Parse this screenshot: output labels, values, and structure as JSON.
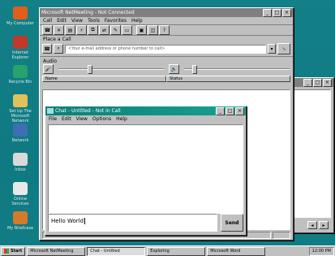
{
  "desktop": {
    "icons": [
      {
        "label": "My Computer",
        "color": "#e35d1c",
        "icon": "my-computer-icon"
      },
      {
        "label": "Internet Explorer",
        "color": "#c0392b",
        "icon": "internet-icon"
      },
      {
        "label": "Recycle Bin",
        "color": "#27a36b",
        "icon": "recycle-bin-icon"
      },
      {
        "label": "Set Up The Microsoft Network",
        "color": "#e2c15a",
        "icon": "msn-icon"
      },
      {
        "label": "Network",
        "color": "#3e6fb5",
        "icon": "network-icon"
      },
      {
        "label": "Inbox",
        "color": "#d9d9d9",
        "icon": "inbox-icon"
      },
      {
        "label": "Online Services",
        "color": "#e8e8e8",
        "icon": "online-services-icon"
      },
      {
        "label": "My Briefcase",
        "color": "#d47a2a",
        "icon": "briefcase-icon"
      }
    ]
  },
  "netmeeting": {
    "title": "Microsoft NetMeeting - Not Connected",
    "menu": [
      "Call",
      "Edit",
      "View",
      "Tools",
      "Favorites",
      "Help"
    ],
    "place_call_label": "Place a Call",
    "address_placeholder": "<Your e-mail address or phone number to call>",
    "audio_label": "Audio",
    "columns": [
      "Name",
      "Status"
    ],
    "status_text": "Not Connected"
  },
  "chat": {
    "title": "Chat - Untitled - Not in Call",
    "menu": [
      "File",
      "Edit",
      "View",
      "Options",
      "Help"
    ],
    "message_value": "Hello World",
    "send_label": "Send"
  },
  "background_window": {
    "title": ""
  },
  "taskbar": {
    "start_label": "Start",
    "tasks": [
      "Microsoft NetMeeting",
      "Chat - Untitled",
      "Exploring",
      "Microsoft Word"
    ],
    "clock": "12:00 PM"
  },
  "colors": {
    "desktop": "#0f7a82",
    "title_active": "#000080",
    "title_inactive": "#808080"
  }
}
